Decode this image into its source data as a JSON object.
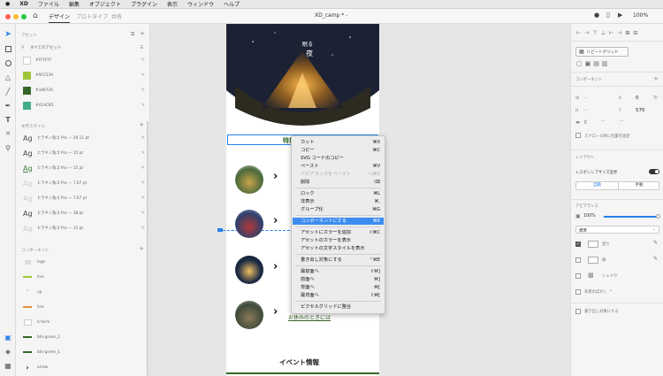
{
  "menubar": {
    "apple": "",
    "app": "XD",
    "items": [
      "ファイル",
      "編集",
      "オブジェクト",
      "プラグイン",
      "表示",
      "ウィンドウ",
      "ヘルプ"
    ]
  },
  "titlebar": {
    "tabs": [
      "デザイン",
      "プロトタイプ",
      "共有"
    ],
    "doc_title": "XD_camp *",
    "zoom": "100%"
  },
  "assets": {
    "header": "アセット",
    "filter": "すべてのアセット",
    "colors": [
      {
        "label": "#FFFFFF",
        "hex": "#ffffff"
      },
      {
        "label": "#9FC539",
        "hex": "#9fc539"
      },
      {
        "label": "#346726",
        "hex": "#346726"
      },
      {
        "label": "#41AC85",
        "hex": "#41ac85"
      }
    ],
    "char_header": "文字スタイル",
    "char_styles": [
      {
        "ag": "Ag",
        "label": "ヒラギノ角ゴ Pro — 29.11 pt"
      },
      {
        "ag": "Ag",
        "label": "ヒラギノ角ゴ Pro — 15 pt"
      },
      {
        "ag": "Ag",
        "label": "ヒラギノ角ゴ Pro — 15 pt"
      },
      {
        "ag": "Ag",
        "label": "ヒラギノ角ゴ Pro — 7.67 pt"
      },
      {
        "ag": "Ag",
        "label": "ヒラギノ角ゴ Pro — 7.67 pt"
      },
      {
        "ag": "Ag",
        "label": "ヒラギノ角ゴ Pro — 38 pt"
      },
      {
        "ag": "Ag",
        "label": "ヒラギノ角ゴ Pro — 15 pt"
      }
    ],
    "comp_header": "コンポーネント",
    "components": [
      "logo",
      "line",
      "up",
      "line",
      "h-form",
      "btn-green_2",
      "btn-green_1",
      "arrow"
    ]
  },
  "artboard": {
    "hero_text": "眠る",
    "hero_text2": "夜",
    "special_title": "特集",
    "link_text": "お休みのときには",
    "event_title": "イベント情報"
  },
  "context_menu": {
    "items": [
      {
        "label": "カット",
        "sc": "⌘X"
      },
      {
        "label": "コピー",
        "sc": "⌘C"
      },
      {
        "label": "SVG コードのコピー",
        "sc": ""
      },
      {
        "label": "ペースト",
        "sc": "⌘V"
      },
      {
        "label": "アピアランスをペースト",
        "sc": "⌥⌘V"
      },
      {
        "label": "削除",
        "sc": "⌫"
      },
      {
        "label": "ロック",
        "sc": "⌘L"
      },
      {
        "label": "非表示",
        "sc": "⌘,"
      },
      {
        "label": "グループ化",
        "sc": "⌘G"
      },
      {
        "label": "コンポーネントにする",
        "sc": "⌘K"
      },
      {
        "label": "アセットにカラーを追加",
        "sc": "⇧⌘C"
      },
      {
        "label": "アセットのカラーを表示",
        "sc": ""
      },
      {
        "label": "アセットの文字スタイルを表示",
        "sc": ""
      },
      {
        "label": "書き出し対象にする",
        "sc": "⌃⌘E"
      },
      {
        "label": "最前面へ",
        "sc": "⇧⌘]"
      },
      {
        "label": "前面へ",
        "sc": "⌘]"
      },
      {
        "label": "背面へ",
        "sc": "⌘["
      },
      {
        "label": "最背面へ",
        "sc": "⇧⌘["
      },
      {
        "label": "ピクセルグリッドに整合",
        "sc": ""
      }
    ]
  },
  "props": {
    "repeat_grid": "リピートグリッド",
    "component_header": "コンポーネント",
    "w_label": "W",
    "w_value": "0",
    "h_label": "H",
    "h_value": "570",
    "x_value": "0",
    "fix_scroll": "スクロール時に位置を固定",
    "layout_header": "レイアウト",
    "responsive": "レスポンシブサイズ変更",
    "auto": "自動",
    "manual": "手動",
    "appearance_header": "アピアランス",
    "opacity": "100%",
    "blend": "標準",
    "fill": "塗り",
    "border": "線",
    "shadow": "シャドウ",
    "bg_blur": "背景のぼかし",
    "export_target": "書き出し対象にする"
  }
}
